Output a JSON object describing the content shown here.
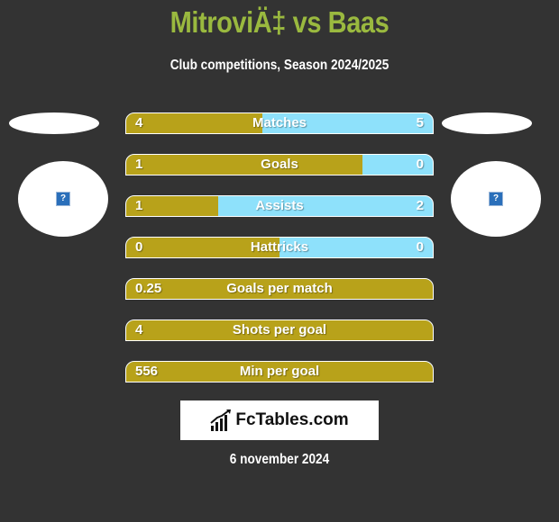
{
  "header": {
    "title": "MitroviÄ‡ vs Baas",
    "subtitle": "Club competitions, Season 2024/2025"
  },
  "teams": {
    "left": {
      "logo_icon": "missing-image-icon",
      "logo_glyph": "?"
    },
    "right": {
      "logo_icon": "missing-image-icon",
      "logo_glyph": "?"
    }
  },
  "colors": {
    "title": "#9ab93f",
    "left_bar": "#b8a21a",
    "right_bar": "#8ee1fb",
    "background": "#333333"
  },
  "stats": [
    {
      "label": "Matches",
      "left": "4",
      "right": "5",
      "left_share": 0.444
    },
    {
      "label": "Goals",
      "left": "1",
      "right": "0",
      "left_share": 0.77
    },
    {
      "label": "Assists",
      "left": "1",
      "right": "2",
      "left_share": 0.3
    },
    {
      "label": "Hattricks",
      "left": "0",
      "right": "0",
      "left_share": 0.5
    },
    {
      "label": "Goals per match",
      "left": "0.25",
      "right": "",
      "left_share": 1.0
    },
    {
      "label": "Shots per goal",
      "left": "4",
      "right": "",
      "left_share": 1.0
    },
    {
      "label": "Min per goal",
      "left": "556",
      "right": "",
      "left_share": 1.0
    }
  ],
  "footer": {
    "brand": "FcTables.com",
    "brand_icon": "bar-chart-icon",
    "date": "6 november 2024"
  }
}
